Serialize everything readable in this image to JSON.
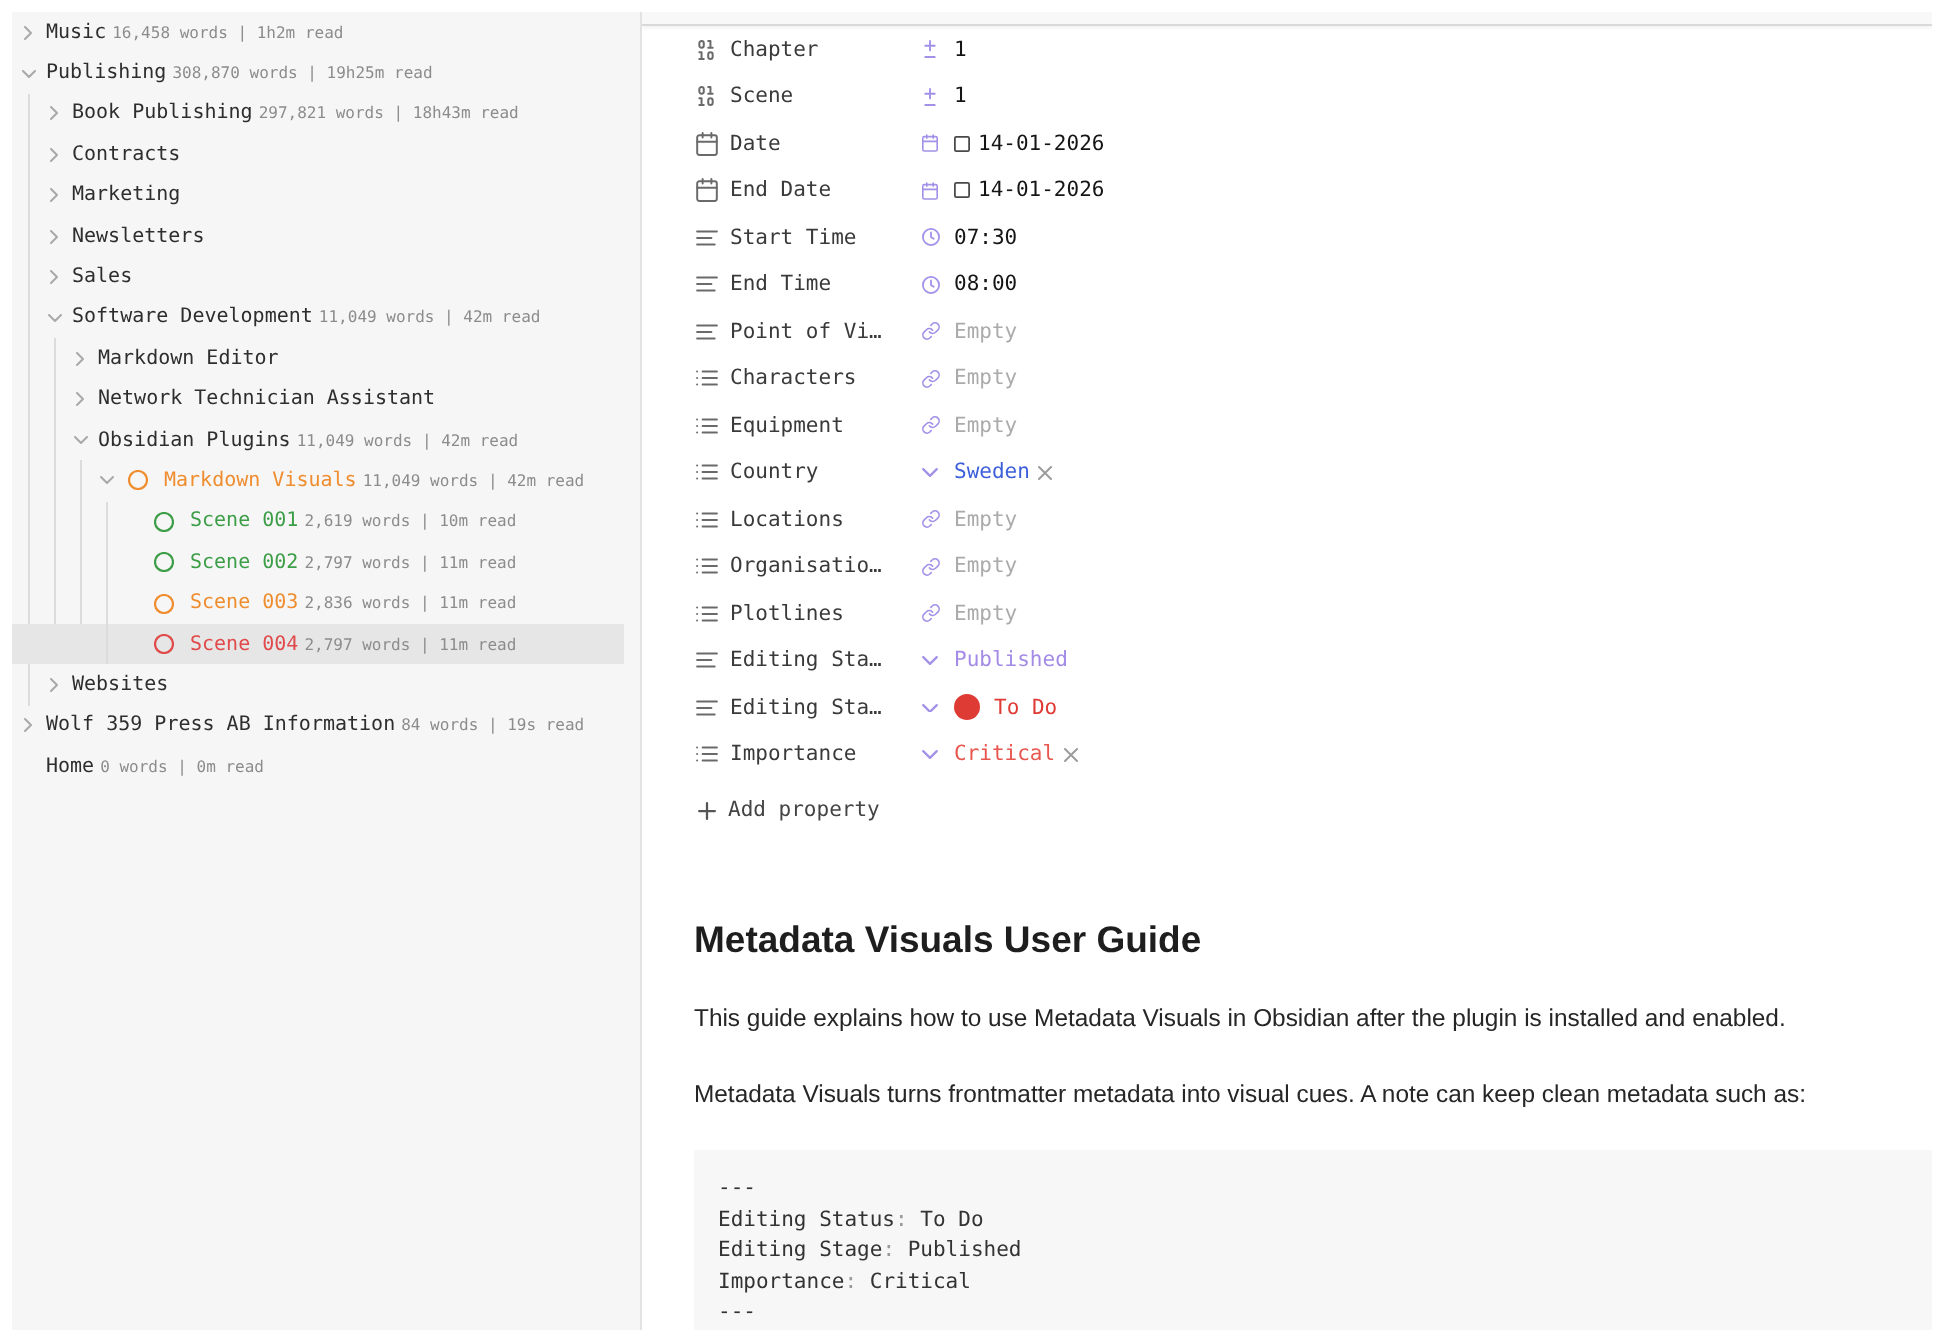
{
  "sidebar": {
    "items": [
      {
        "label": "Music",
        "meta": "16,458 words | 1h2m read",
        "kind": "folder",
        "expanded": false,
        "selected": false
      },
      {
        "label": "Publishing",
        "meta": "308,870 words | 19h25m read",
        "kind": "folder",
        "expanded": true,
        "selected": false,
        "children": [
          {
            "label": "Book Publishing",
            "meta": "297,821 words | 18h43m read",
            "kind": "folder",
            "expanded": false,
            "selected": false
          },
          {
            "label": "Contracts",
            "kind": "folder",
            "expanded": false,
            "selected": false
          },
          {
            "label": "Marketing",
            "kind": "folder",
            "expanded": false,
            "selected": false
          },
          {
            "label": "Newsletters",
            "kind": "folder",
            "expanded": false,
            "selected": false
          },
          {
            "label": "Sales",
            "kind": "folder",
            "expanded": false,
            "selected": false
          },
          {
            "label": "Software Development",
            "meta": "11,049 words | 42m read",
            "kind": "folder",
            "expanded": true,
            "selected": false,
            "children": [
              {
                "label": "Markdown Editor",
                "kind": "folder",
                "expanded": false,
                "selected": false
              },
              {
                "label": "Network Technician Assistant",
                "kind": "folder",
                "expanded": false,
                "selected": false
              },
              {
                "label": "Obsidian Plugins",
                "meta": "11,049 words | 42m read",
                "kind": "folder",
                "expanded": true,
                "selected": false,
                "children": [
                  {
                    "label": "Markdown Visuals",
                    "meta": "11,049 words | 42m read",
                    "kind": "folder",
                    "expanded": true,
                    "selected": false,
                    "color": "#ef8d2f",
                    "children": [
                      {
                        "label": "Scene 001",
                        "meta": "2,619 words | 10m read",
                        "kind": "file",
                        "selected": false,
                        "color": "#3d9e48"
                      },
                      {
                        "label": "Scene 002",
                        "meta": "2,797 words | 11m read",
                        "kind": "file",
                        "selected": false,
                        "color": "#3d9e48"
                      },
                      {
                        "label": "Scene 003",
                        "meta": "2,836 words | 11m read",
                        "kind": "file",
                        "selected": false,
                        "color": "#ef8d2f"
                      },
                      {
                        "label": "Scene 004",
                        "meta": "2,797 words | 11m read",
                        "kind": "file",
                        "selected": true,
                        "color": "#e04a4a"
                      }
                    ]
                  }
                ]
              }
            ]
          },
          {
            "label": "Websites",
            "kind": "folder",
            "expanded": false,
            "selected": false
          }
        ]
      },
      {
        "label": "Wolf 359 Press AB Information",
        "meta": "84 words | 19s read",
        "kind": "folder",
        "expanded": false,
        "selected": false
      },
      {
        "label": "Home",
        "meta": "0 words | 0m read",
        "kind": "file",
        "selected": false
      }
    ]
  },
  "properties": {
    "items": [
      {
        "name": "Chapter",
        "kind": "number",
        "list": false,
        "value": "1",
        "removable": false,
        "dot": false
      },
      {
        "name": "Scene",
        "kind": "number",
        "list": false,
        "value": "1",
        "removable": false,
        "dot": false
      },
      {
        "name": "Date",
        "kind": "date",
        "list": false,
        "value": "14-01-2026",
        "removable": false,
        "dot": false
      },
      {
        "name": "End Date",
        "kind": "date",
        "list": false,
        "value": "14-01-2026",
        "removable": false,
        "dot": false
      },
      {
        "name": "Start Time",
        "kind": "time",
        "list": false,
        "value": "07:30",
        "removable": false,
        "dot": false
      },
      {
        "name": "End Time",
        "kind": "time",
        "list": false,
        "value": "08:00",
        "removable": false,
        "dot": false
      },
      {
        "name": "Point of Vi…",
        "kind": "link",
        "list": false,
        "placeholder": "Empty",
        "removable": false,
        "dot": false
      },
      {
        "name": "Characters",
        "kind": "link",
        "list": true,
        "placeholder": "Empty",
        "removable": false,
        "dot": false
      },
      {
        "name": "Equipment",
        "kind": "link",
        "list": true,
        "placeholder": "Empty",
        "removable": false,
        "dot": false
      },
      {
        "name": "Country",
        "kind": "select",
        "list": true,
        "value": "Sweden",
        "color": "#3d5fd9",
        "removable": true,
        "dot": false
      },
      {
        "name": "Locations",
        "kind": "link",
        "list": true,
        "placeholder": "Empty",
        "removable": false,
        "dot": false
      },
      {
        "name": "Organisatio…",
        "kind": "link",
        "list": true,
        "placeholder": "Empty",
        "removable": false,
        "dot": false
      },
      {
        "name": "Plotlines",
        "kind": "link",
        "list": true,
        "placeholder": "Empty",
        "removable": false,
        "dot": false
      },
      {
        "name": "Editing Sta…",
        "kind": "select",
        "list": false,
        "value": "Published",
        "color": "#a38be6",
        "removable": false,
        "dot": false
      },
      {
        "name": "Editing Sta…",
        "kind": "select",
        "list": false,
        "value": "To Do",
        "color": "#df3b35",
        "removable": false,
        "dot": true
      },
      {
        "name": "Importance",
        "kind": "select",
        "list": true,
        "value": "Critical",
        "color": "#e8574f",
        "removable": true,
        "dot": false
      }
    ],
    "add_label": "Add property"
  },
  "document": {
    "title": "Metadata Visuals User Guide",
    "paragraphs": [
      "This guide explains how to use Metadata Visuals in Obsidian after the plugin is installed and enabled.",
      "Metadata Visuals turns frontmatter metadata into visual cues. A note can keep clean metadata such as:"
    ],
    "code_lines": [
      {
        "kind": "fence",
        "text": "---"
      },
      {
        "kind": "pair",
        "key": "Editing Status",
        "separator": ": ",
        "value": "To Do"
      },
      {
        "kind": "pair",
        "key": "Editing Stage",
        "separator": ": ",
        "value": "Published"
      },
      {
        "kind": "pair",
        "key": "Importance",
        "separator": ": ",
        "value": "Critical"
      },
      {
        "kind": "fence",
        "text": "---"
      }
    ]
  }
}
